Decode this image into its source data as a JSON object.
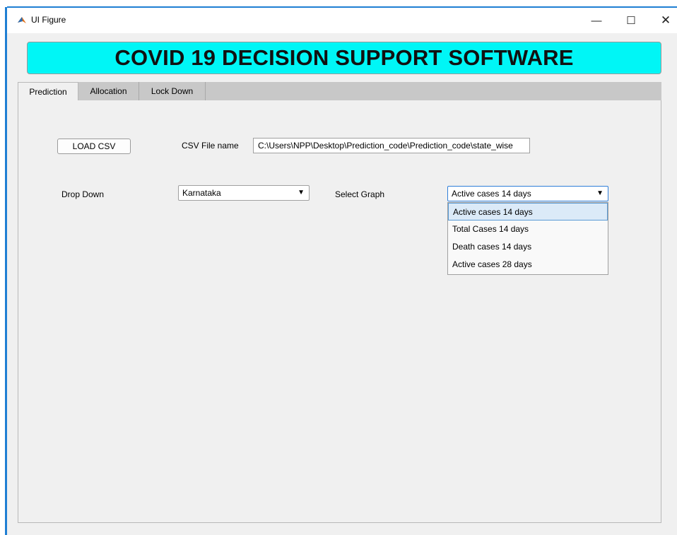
{
  "window": {
    "title": "UI Figure",
    "min_glyph": "—",
    "max_glyph": "☐",
    "close_glyph": "✕"
  },
  "banner": {
    "text": "COVID 19 DECISION SUPPORT SOFTWARE",
    "color": "#00f6f6"
  },
  "tabs": [
    {
      "label": "Prediction",
      "active": true
    },
    {
      "label": "Allocation",
      "active": false
    },
    {
      "label": "Lock Down",
      "active": false
    }
  ],
  "prediction": {
    "load_button": "LOAD CSV",
    "csv_label": "CSV File name",
    "csv_value": "C:\\Users\\NPP\\Desktop\\Prediction_code\\Prediction_code\\state_wise",
    "dropdown_label": "Drop Down",
    "dropdown_value": "Karnataka",
    "graph_label": "Select Graph",
    "graph_value": "Active cases 14 days",
    "graph_options": [
      "Active cases 14 days",
      "Total Cases 14 days",
      "Death cases 14 days",
      "Active cases 28 days"
    ],
    "arrow_glyph": "▼"
  },
  "icons": {
    "app": "matlab-icon",
    "arrow": "dropdown-arrow-icon"
  },
  "colors": {
    "accent": "#1f7fd3",
    "selection": "#dbeaf8"
  }
}
